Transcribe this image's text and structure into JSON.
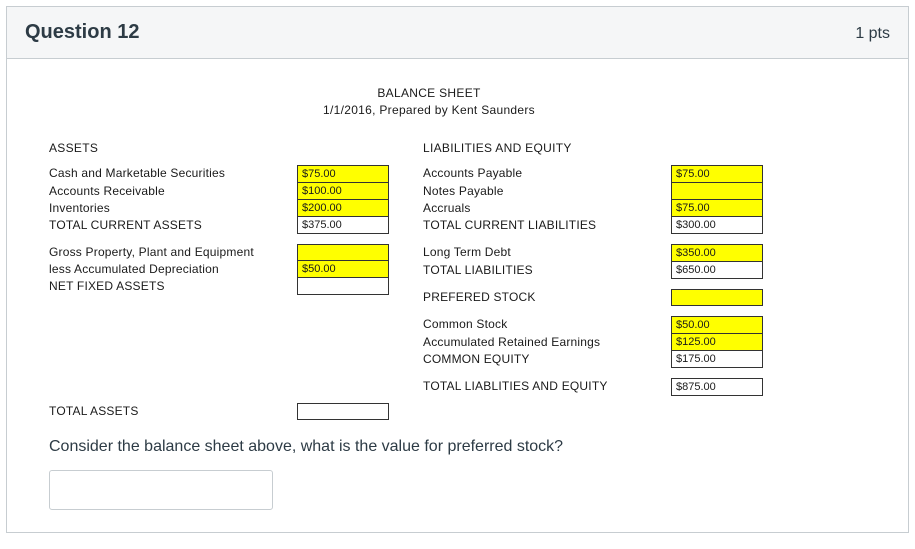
{
  "question": {
    "title": "Question 12",
    "points": "1 pts"
  },
  "sheet": {
    "title_line1": "BALANCE SHEET",
    "title_line2": "1/1/2016, Prepared by Kent Saunders",
    "assets": {
      "heading": "ASSETS",
      "cash_label": "Cash and Marketable Securities",
      "cash_value": "$75.00",
      "ar_label": "Accounts Receivable",
      "ar_value": "$100.00",
      "inv_label": "Inventories",
      "inv_value": "$200.00",
      "tca_label": "TOTAL CURRENT ASSETS",
      "tca_value": "$375.00",
      "gppe_label": "Gross Property, Plant and Equipment",
      "gppe_value": "",
      "dep_label": "less Accumulated Depreciation",
      "dep_value": "$50.00",
      "nfa_label": "NET FIXED ASSETS",
      "nfa_value": "",
      "total_label": "TOTAL ASSETS",
      "total_value": ""
    },
    "liab": {
      "heading": "LIABILITIES AND EQUITY",
      "ap_label": "Accounts Payable",
      "ap_value": "$75.00",
      "np_label": "Notes Payable",
      "np_value": "",
      "acc_label": "Accruals",
      "acc_value": "$75.00",
      "tcl_label": "TOTAL CURRENT LIABILITIES",
      "tcl_value": "$300.00",
      "ltd_label": "Long Term Debt",
      "ltd_value": "$350.00",
      "tl_label": "TOTAL LIABILITIES",
      "tl_value": "$650.00",
      "ps_label": "PREFERED STOCK",
      "ps_value": "",
      "cs_label": "Common Stock",
      "cs_value": "$50.00",
      "re_label": "Accumulated Retained Earnings",
      "re_value": "$125.00",
      "ce_label": "COMMON EQUITY",
      "ce_value": "$175.00",
      "tle_label": "TOTAL LIABLITIES AND EQUITY",
      "tle_value": "$875.00"
    }
  },
  "prompt": "Consider the balance sheet above, what is the value for preferred stock?",
  "answer_value": ""
}
